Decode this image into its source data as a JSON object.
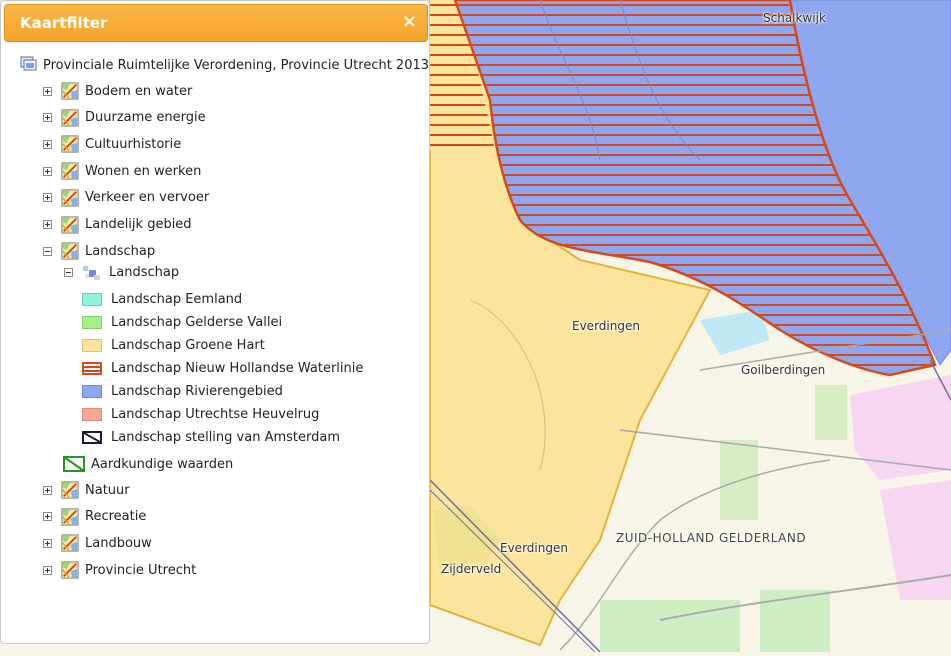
{
  "panel": {
    "title": "Kaartfilter",
    "close_icon": "×",
    "root_label": "Provinciale Ruimtelijke Verordening, Provincie Utrecht 2013",
    "groups_before": [
      {
        "label": "Bodem en water",
        "state": "collapsed"
      },
      {
        "label": "Duurzame energie",
        "state": "collapsed"
      },
      {
        "label": "Cultuurhistorie",
        "state": "collapsed"
      },
      {
        "label": "Wonen en werken",
        "state": "collapsed"
      },
      {
        "label": "Verkeer en vervoer",
        "state": "collapsed"
      },
      {
        "label": "Landelijk gebied",
        "state": "collapsed"
      },
      {
        "label": "Landschap",
        "state": "expanded"
      }
    ],
    "sublayer_label": "Landschap",
    "legend": [
      {
        "label": "Landschap Eemland",
        "fill": "#8ff5da",
        "border": "#6fc8b3",
        "pattern": "solid"
      },
      {
        "label": "Landschap Gelderse Vallei",
        "fill": "#a7f08a",
        "border": "#86c86e",
        "pattern": "solid"
      },
      {
        "label": "Landschap Groene Hart",
        "fill": "#fbe59c",
        "border": "#dcc47a",
        "pattern": "solid"
      },
      {
        "label": "Landschap Nieuw Hollandse Waterlinie",
        "fill": "#ffffff",
        "border": "#d64a1a",
        "pattern": "hlines"
      },
      {
        "label": "Landschap Rivierengebied",
        "fill": "#8fa6f0",
        "border": "#7088d6",
        "pattern": "solid"
      },
      {
        "label": "Landschap Utrechtse Heuvelrug",
        "fill": "#f7a793",
        "border": "#de8a76",
        "pattern": "solid"
      },
      {
        "label": "Landschap stelling van Amsterdam",
        "fill": "#ffffff",
        "border": "#1a1a3a",
        "pattern": "diagonal"
      }
    ],
    "aardkundige_label": "Aardkundige waarden",
    "groups_after": [
      {
        "label": "Natuur",
        "state": "collapsed"
      },
      {
        "label": "Recreatie",
        "state": "collapsed"
      },
      {
        "label": "Landbouw",
        "state": "collapsed"
      },
      {
        "label": "Provincie Utrecht",
        "state": "collapsed"
      }
    ]
  },
  "map": {
    "labels": {
      "schalkwijk": "Schalkwijk",
      "everdingen_north": "Everdingen",
      "goilberdingen": "Goilberdingen",
      "everdingen_south": "Everdingen",
      "zijderveld": "Zijderveld",
      "region": "ZUID-HOLLAND GELDERLAND"
    },
    "colors": {
      "background": "#f7f5e8",
      "groene_hart": "#fbe59c",
      "rivierengebied": "#8fa6f0",
      "waterlinie_outline": "#d64a1a"
    }
  }
}
